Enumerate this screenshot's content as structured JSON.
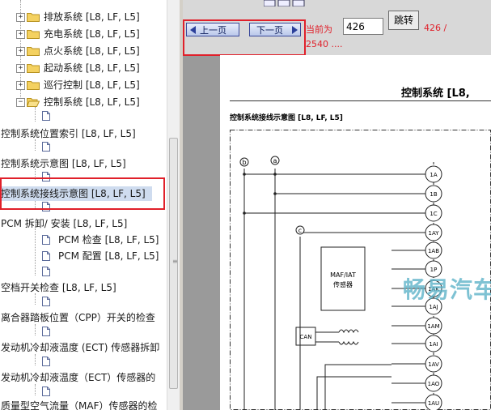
{
  "tree": {
    "items": [
      {
        "label": "排放系统 [L8, LF, L5]",
        "type": "folder",
        "expander": "+"
      },
      {
        "label": "充电系统 [L8, LF, L5]",
        "type": "folder",
        "expander": "+"
      },
      {
        "label": "点火系统 [L8, LF, L5]",
        "type": "folder",
        "expander": "+"
      },
      {
        "label": "起动系统 [L8, LF, L5]",
        "type": "folder",
        "expander": "+"
      },
      {
        "label": "巡行控制 [L8, LF, L5]",
        "type": "folder",
        "expander": "+"
      },
      {
        "label": "控制系统 [L8, LF, L5]",
        "type": "folder-open",
        "expander": "−"
      },
      {
        "label": "控制系统位置索引 [L8, LF, L5]",
        "type": "doc"
      },
      {
        "label": "控制系统示意图 [L8, LF, L5]",
        "type": "doc"
      },
      {
        "label": "控制系统接线示意图 [L8, LF, L5]",
        "type": "doc",
        "selected": true
      },
      {
        "label": "PCM 拆卸/ 安装 [L8, LF, L5]",
        "type": "doc"
      },
      {
        "label": "PCM 检查 [L8, LF, L5]",
        "type": "doc"
      },
      {
        "label": "PCM 配置 [L8, LF, L5]",
        "type": "doc"
      },
      {
        "label": "空档开关检查 [L8, LF, L5]",
        "type": "doc"
      },
      {
        "label": "离合器踏板位置（CPP）开关的检查",
        "type": "doc"
      },
      {
        "label": "发动机冷却液温度 (ECT) 传感器拆卸",
        "type": "doc"
      },
      {
        "label": "发动机冷却液温度（ECT）传感器的",
        "type": "doc"
      },
      {
        "label": "质量型空气流量（MAF）传感器的检",
        "type": "doc"
      }
    ]
  },
  "toolbar": {
    "prev_label": "上一页",
    "next_label": "下一页",
    "current_label": "当前为",
    "page_value": "426",
    "go_label": "跳转",
    "page_info_line1": "426 /",
    "page_info_line2": "2540 ...."
  },
  "document": {
    "header": "控制系统 [L8,",
    "diagram_title": "控制系统接线示意图 [L8, LF, L5]",
    "bus_labels": [
      "b",
      "a",
      "c"
    ],
    "connector_pins": [
      "1A",
      "1B",
      "1C",
      "1AY",
      "1AB",
      "1P",
      "1AK",
      "1AJ",
      "1AM",
      "1AI",
      "1AV",
      "1AO",
      "1AU"
    ],
    "maf_label_line1": "MAF/IAT",
    "maf_label_line2": "传感器",
    "can_label": "CAN",
    "watermark": "畅易汽车维"
  },
  "colors": {
    "selection": "#cfdcef",
    "highlight_box": "#e0202a",
    "nav_button_border": "#39489a",
    "page_info_text": "#e0202a",
    "watermark": "#5fb4c9"
  }
}
